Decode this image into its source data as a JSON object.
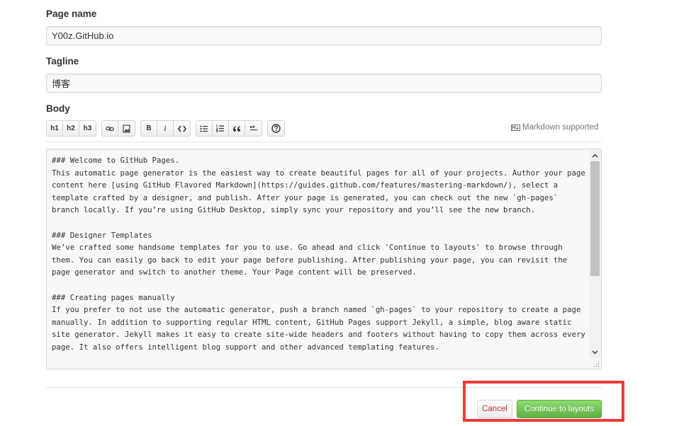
{
  "form": {
    "page_name_label": "Page name",
    "page_name_value": "Y00z.GitHub.io",
    "tagline_label": "Tagline",
    "tagline_value": "博客",
    "body_label": "Body"
  },
  "toolbar": {
    "h1": "h1",
    "h2": "h2",
    "h3": "h3",
    "bold": "B",
    "italic": "i",
    "icons": [
      "link-icon",
      "image-icon",
      "code-icon",
      "unordered-list-icon",
      "ordered-list-icon",
      "blockquote-icon",
      "horizontal-rule-icon",
      "help-icon"
    ],
    "markdown_note": "Markdown supported"
  },
  "body": {
    "content": "### Welcome to GitHub Pages.\nThis automatic page generator is the easiest way to create beautiful pages for all of your projects. Author your page content here [using GitHub Flavored Markdown](https://guides.github.com/features/mastering-markdown/), select a template crafted by a designer, and publish. After your page is generated, you can check out the new `gh-pages` branch locally. If you’re using GitHub Desktop, simply sync your repository and you’ll see the new branch.\n\n### Designer Templates\nWe’ve crafted some handsome templates for you to use. Go ahead and click 'Continue to layouts' to browse through them. You can easily go back to edit your page before publishing. After publishing your page, you can revisit the page generator and switch to another theme. Your Page content will be preserved.\n\n### Creating pages manually\nIf you prefer to not use the automatic generator, push a branch named `gh-pages` to your repository to create a page manually. In addition to supporting regular HTML content, GitHub Pages support Jekyll, a simple, blog aware static site generator. Jekyll makes it easy to create site-wide headers and footers without having to copy them across every page. It also offers intelligent blog support and other advanced templating features."
  },
  "actions": {
    "cancel_label": "Cancel",
    "continue_label": "Continue to layouts"
  },
  "colors": {
    "continue_green": "#60b044",
    "cancel_red": "#b33630",
    "highlight_red": "#ee3a3a"
  }
}
